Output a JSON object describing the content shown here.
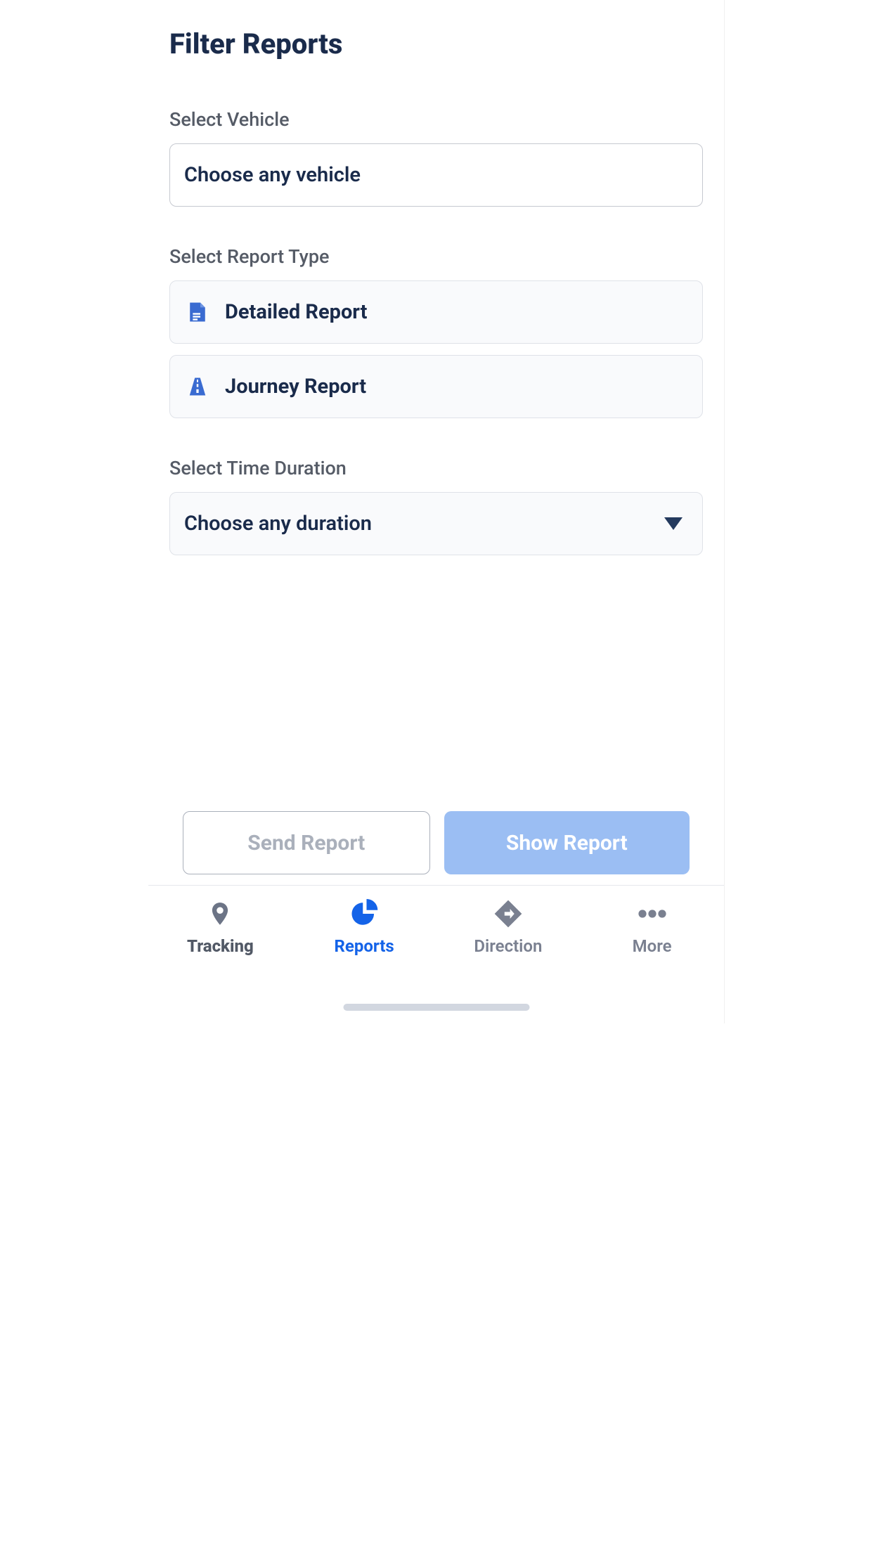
{
  "page": {
    "title": "Filter Reports"
  },
  "colors": {
    "primaryText": "#1a2b4b",
    "muted": "#555b66",
    "accent": "#1463e8",
    "buttonPrimaryBg": "#9bbef3",
    "iconBlue": "#3a6bd1"
  },
  "selectVehicle": {
    "label": "Select Vehicle",
    "placeholder": "Choose any vehicle"
  },
  "selectReportType": {
    "label": "Select Report Type",
    "options": [
      {
        "icon": "document-icon",
        "label": "Detailed Report"
      },
      {
        "icon": "road-icon",
        "label": "Journey Report"
      }
    ]
  },
  "selectDuration": {
    "label": "Select Time Duration",
    "placeholder": "Choose any duration"
  },
  "actions": {
    "send": "Send Report",
    "show": "Show Report"
  },
  "tabs": [
    {
      "icon": "pin-icon",
      "label": "Tracking",
      "active": false
    },
    {
      "icon": "piechart-icon",
      "label": "Reports",
      "active": true
    },
    {
      "icon": "directions-icon",
      "label": "Direction",
      "active": false
    },
    {
      "icon": "more-icon",
      "label": "More",
      "active": false
    }
  ]
}
